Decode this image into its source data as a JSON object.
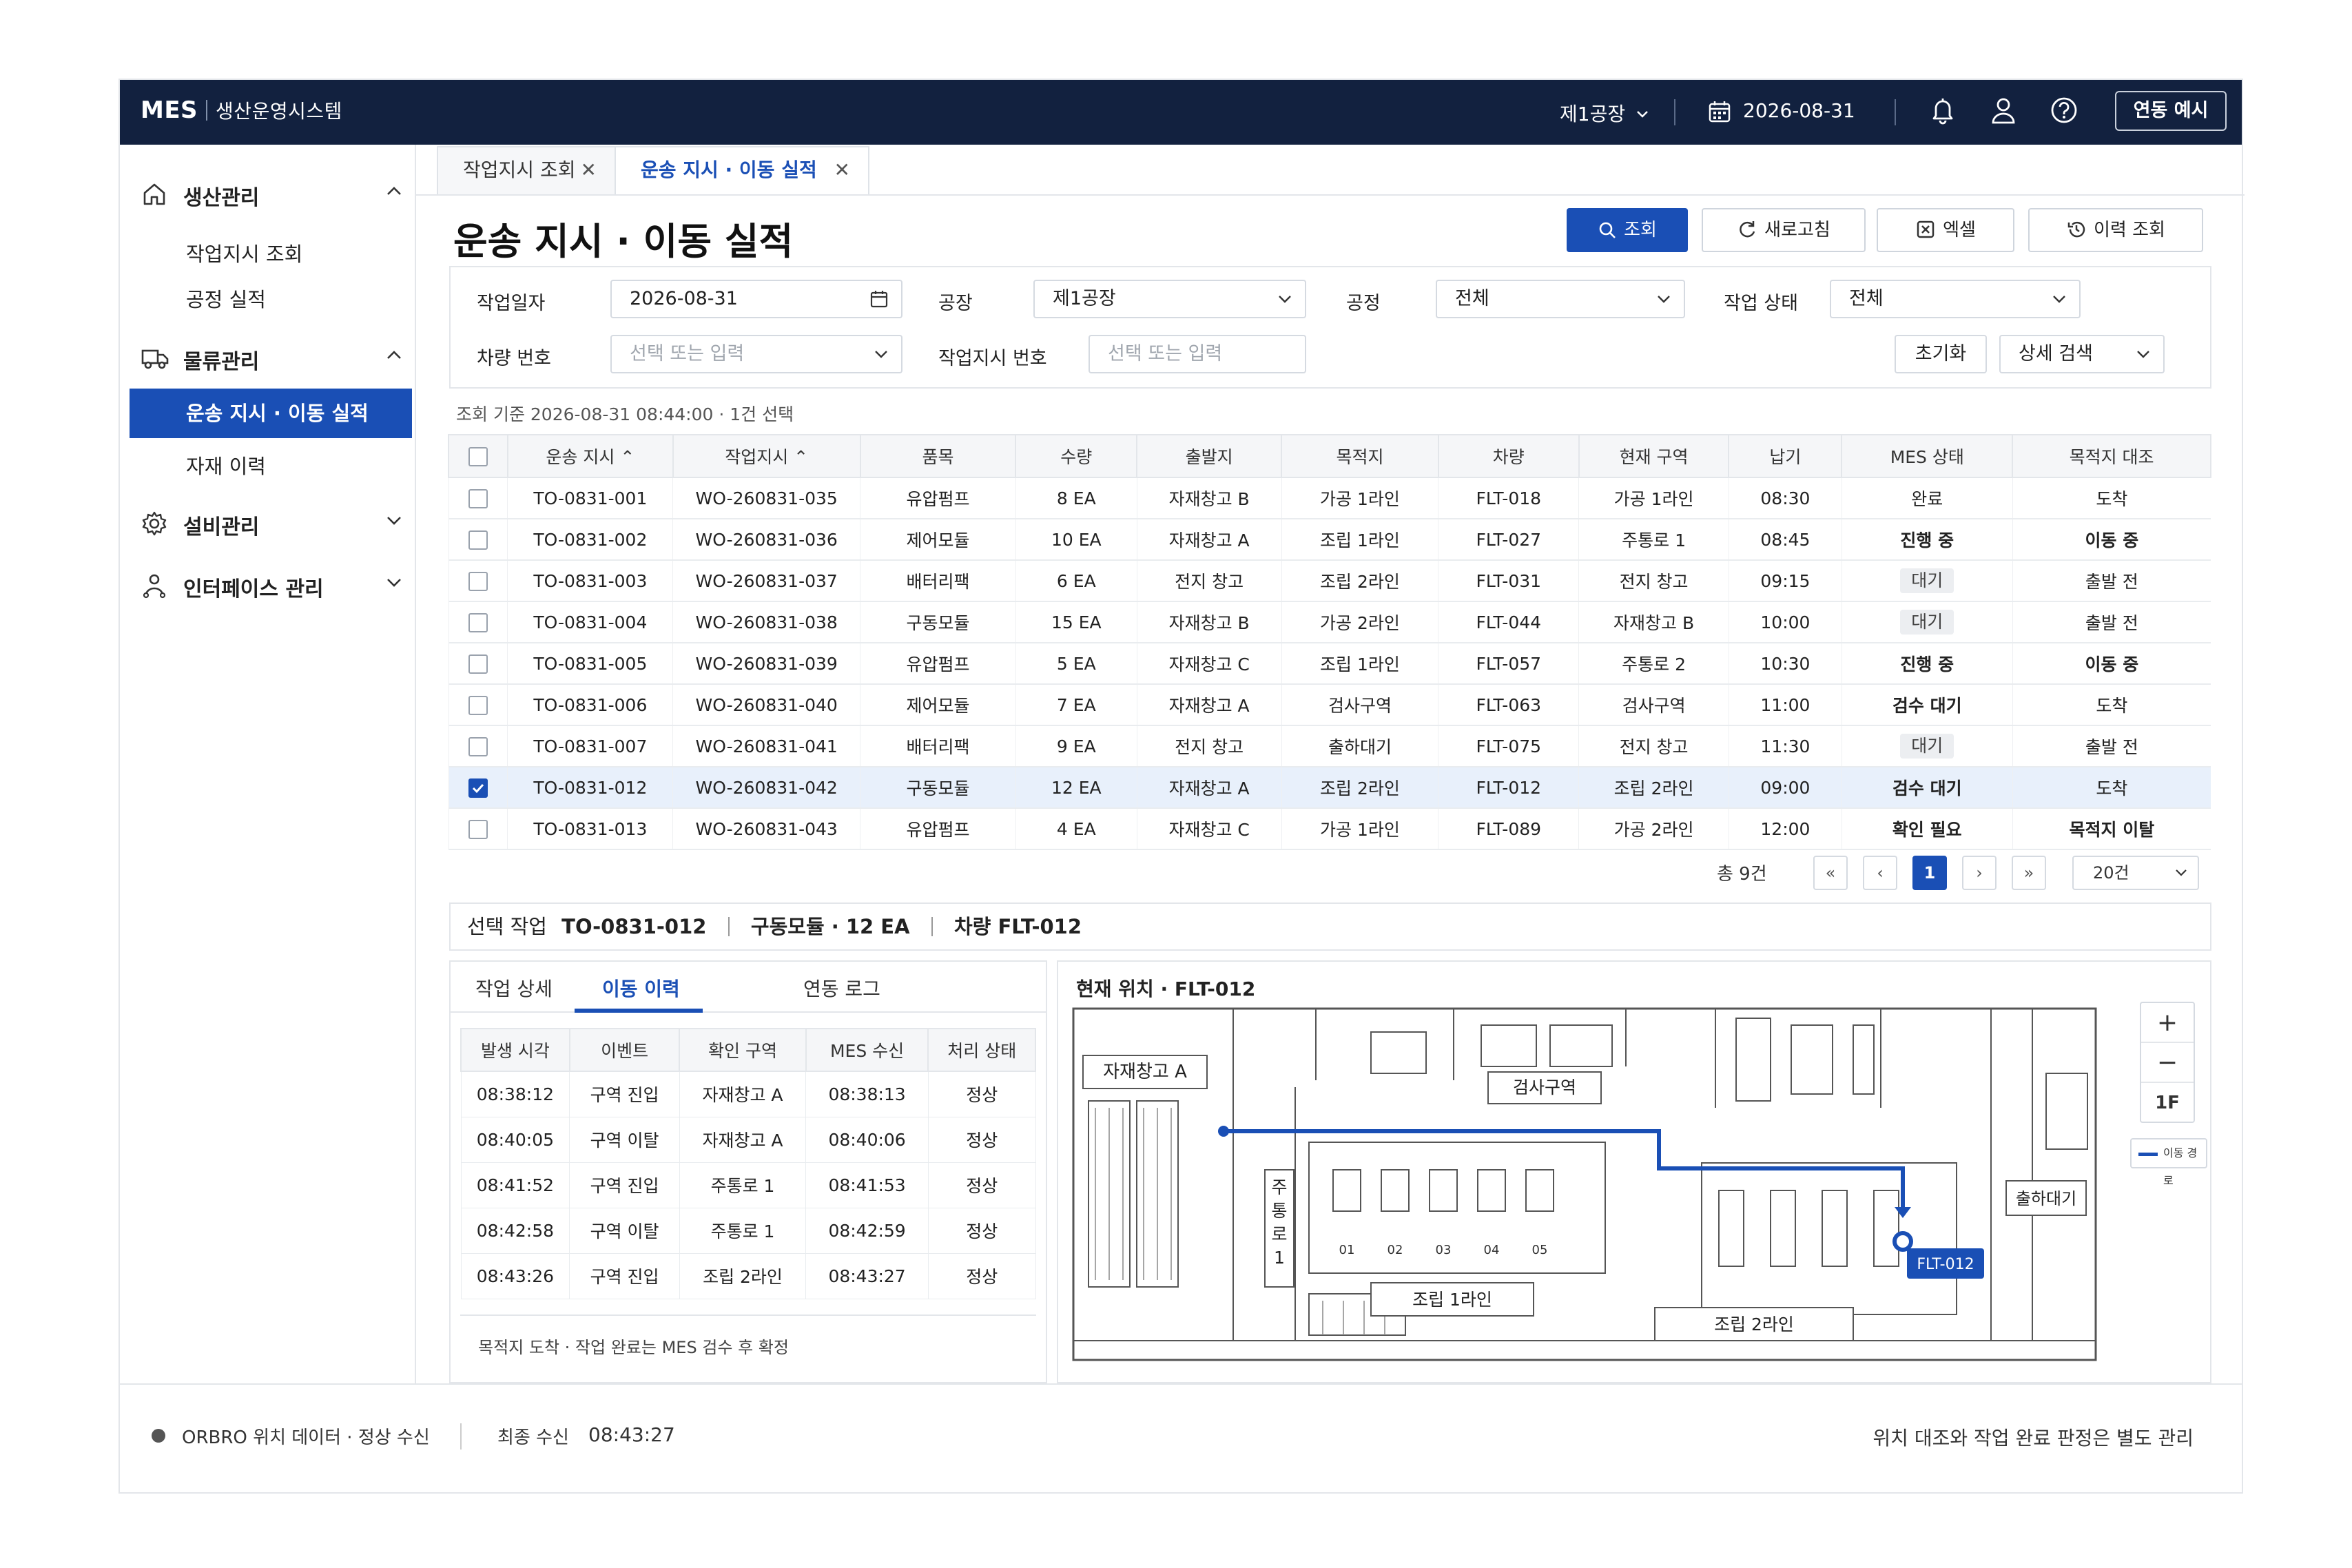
{
  "app": {
    "brand": "MES",
    "subtitle": "생산운영시스템"
  },
  "topbar": {
    "plant": "제1공장",
    "date": "2026-08-31",
    "link_button": "연동 예시"
  },
  "sidebar": {
    "groups": [
      {
        "label": "생산관리",
        "items": [
          "작업지시 조회",
          "공정 실적"
        ]
      },
      {
        "label": "물류관리",
        "items": [
          "운송 지시 · 이동 실적",
          "자재 이력"
        ]
      },
      {
        "label": "설비관리"
      },
      {
        "label": "인터페이스 관리"
      }
    ]
  },
  "tabs": [
    {
      "label": "작업지시 조회"
    },
    {
      "label": "운송 지시 · 이동 실적"
    }
  ],
  "page": {
    "title": "운송 지시 · 이동 실적"
  },
  "actions": {
    "search": "조회",
    "refresh": "새로고침",
    "excel": "엑셀",
    "history": "이력 조회"
  },
  "filters": {
    "work_date_label": "작업일자",
    "work_date": "2026-08-31",
    "plant_label": "공장",
    "plant": "제1공장",
    "process_label": "공정",
    "process": "전체",
    "status_label": "작업 상태",
    "status": "전체",
    "vehicle_label": "차량 번호",
    "vehicle_ph": "선택 또는 입력",
    "wo_label": "작업지시 번호",
    "wo_ph": "선택 또는 입력",
    "reset": "초기화",
    "advanced": "상세 검색"
  },
  "meta": "조회 기준  2026-08-31 08:44:00 · 1건 선택",
  "table": {
    "columns": [
      "운송 지시 ⌃",
      "작업지시 ⌃",
      "품목",
      "수량",
      "출발지",
      "목적지",
      "차량",
      "현재 구역",
      "납기",
      "MES 상태",
      "목적지 대조"
    ],
    "rows": [
      [
        "TO-0831-001",
        "WO-260831-035",
        "유압펌프",
        "8 EA",
        "자재창고 B",
        "가공 1라인",
        "FLT-018",
        "가공 1라인",
        "08:30",
        "완료",
        "도착"
      ],
      [
        "TO-0831-002",
        "WO-260831-036",
        "제어모듈",
        "10 EA",
        "자재창고 A",
        "조립 1라인",
        "FLT-027",
        "주통로 1",
        "08:45",
        "진행 중",
        "이동 중"
      ],
      [
        "TO-0831-003",
        "WO-260831-037",
        "배터리팩",
        "6 EA",
        "전지 창고",
        "조립 2라인",
        "FLT-031",
        "전지 창고",
        "09:15",
        "대기",
        "출발 전"
      ],
      [
        "TO-0831-004",
        "WO-260831-038",
        "구동모듈",
        "15 EA",
        "자재창고 B",
        "가공 2라인",
        "FLT-044",
        "자재창고 B",
        "10:00",
        "대기",
        "출발 전"
      ],
      [
        "TO-0831-005",
        "WO-260831-039",
        "유압펌프",
        "5 EA",
        "자재창고 C",
        "조립 1라인",
        "FLT-057",
        "주통로 2",
        "10:30",
        "진행 중",
        "이동 중"
      ],
      [
        "TO-0831-006",
        "WO-260831-040",
        "제어모듈",
        "7 EA",
        "자재창고 A",
        "검사구역",
        "FLT-063",
        "검사구역",
        "11:00",
        "검수 대기",
        "도착"
      ],
      [
        "TO-0831-007",
        "WO-260831-041",
        "배터리팩",
        "9 EA",
        "전지 창고",
        "출하대기",
        "FLT-075",
        "전지 창고",
        "11:30",
        "대기",
        "출발 전"
      ],
      [
        "TO-0831-012",
        "WO-260831-042",
        "구동모듈",
        "12 EA",
        "자재창고 A",
        "조립 2라인",
        "FLT-012",
        "조립 2라인",
        "09:00",
        "검수 대기",
        "도착"
      ],
      [
        "TO-0831-013",
        "WO-260831-043",
        "유압펌프",
        "4 EA",
        "자재창고 C",
        "가공 1라인",
        "FLT-089",
        "가공 2라인",
        "12:00",
        "확인 필요",
        "목적지 이탈"
      ]
    ],
    "selected_row": 7
  },
  "pager": {
    "total": "총 9건",
    "page": "1",
    "page_size": "20건",
    "first": "«",
    "prev": "‹",
    "next": "›",
    "last": "»"
  },
  "selection": {
    "label": "선택 작업",
    "task": "TO-0831-012",
    "item": "구동모듈 · 12 EA",
    "vehicle": "차량 FLT-012"
  },
  "detail_tabs": [
    "작업 상세",
    "이동 이력",
    "연동 로그"
  ],
  "history": {
    "columns": [
      "발생 시각",
      "이벤트",
      "확인 구역",
      "MES 수신",
      "처리 상태"
    ],
    "rows": [
      [
        "08:38:12",
        "구역 진입",
        "자재창고 A",
        "08:38:13",
        "정상"
      ],
      [
        "08:40:05",
        "구역 이탈",
        "자재창고 A",
        "08:40:06",
        "정상"
      ],
      [
        "08:41:52",
        "구역 진입",
        "주통로 1",
        "08:41:53",
        "정상"
      ],
      [
        "08:42:58",
        "구역 이탈",
        "주통로 1",
        "08:42:59",
        "정상"
      ],
      [
        "08:43:26",
        "구역 진입",
        "조립 2라인",
        "08:43:27",
        "정상"
      ]
    ],
    "note": "목적지 도착 · 작업 완료는 MES 검수 후 확정"
  },
  "map": {
    "title": "현재 위치 · FLT-012",
    "zones": {
      "warehouse_a": "자재창고 A",
      "inspection": "검사구역",
      "aisle": "주\n통\n로\n1",
      "assembly1": "조립 1라인",
      "assembly2": "조립 2라인",
      "shipping": "출하대기"
    },
    "stations": [
      "01",
      "02",
      "03",
      "04",
      "05"
    ],
    "vehicle": "FLT-012",
    "zoom_in": "+",
    "zoom_out": "−",
    "floor": "1F",
    "legend": "이동 경로",
    "route_color": "#1a4fb5"
  },
  "footer": {
    "source": "ORBRO 위치 데이터 · 정상 수신",
    "last_label": "최종 수신",
    "last_time": "08:43:27",
    "right_note": "위치 대조와 작업 완료 판정은 별도 관리"
  },
  "colors": {
    "navy": "#12213f",
    "accent": "#1a4fb5",
    "warn": "#e0502a"
  }
}
